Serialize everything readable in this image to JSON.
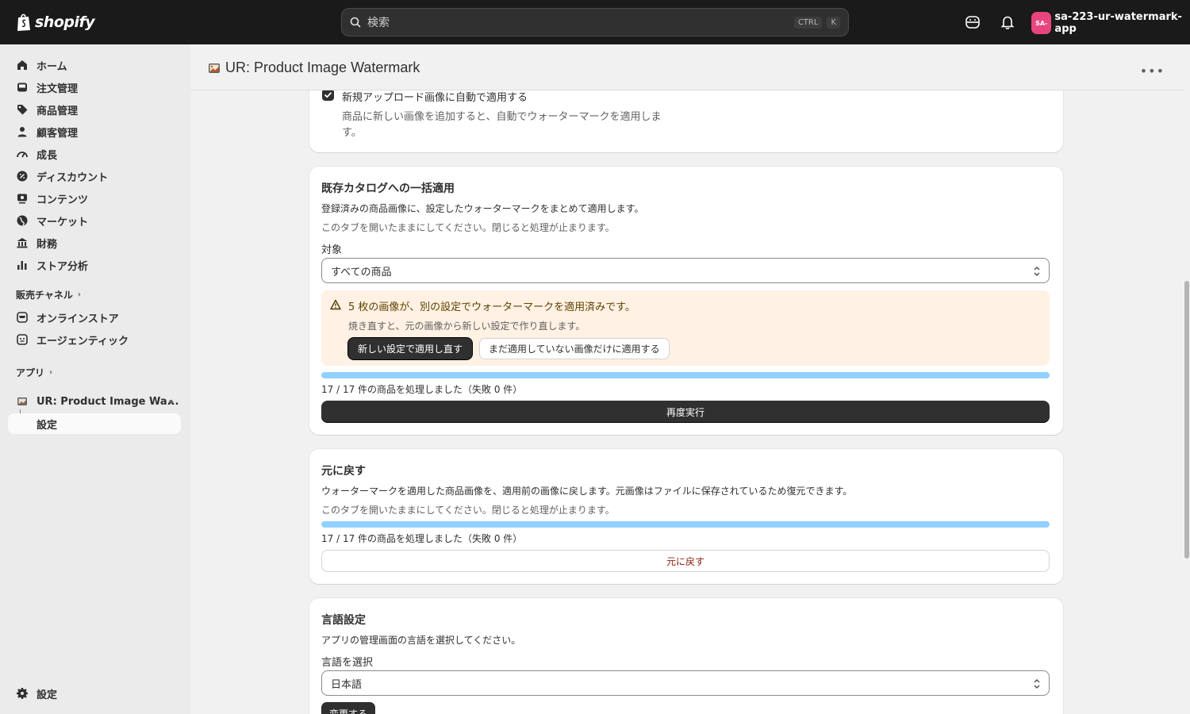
{
  "topbar": {
    "logo_text": "shopify",
    "search_placeholder": "検索",
    "shortcut_ctrl": "CTRL",
    "shortcut_key": "K",
    "avatar_initials": "SA-",
    "store_name": "sa-223-ur-watermark-app"
  },
  "sidebar": {
    "items": [
      {
        "label": "ホーム",
        "icon": "home-icon"
      },
      {
        "label": "注文管理",
        "icon": "inbox-icon"
      },
      {
        "label": "商品管理",
        "icon": "tag-icon"
      },
      {
        "label": "顧客管理",
        "icon": "person-icon"
      },
      {
        "label": "成長",
        "icon": "gauge-icon"
      },
      {
        "label": "ディスカウント",
        "icon": "discount-icon"
      },
      {
        "label": "コンテンツ",
        "icon": "content-icon"
      },
      {
        "label": "マーケット",
        "icon": "globe-icon"
      },
      {
        "label": "財務",
        "icon": "bank-icon"
      },
      {
        "label": "ストア分析",
        "icon": "chart-icon"
      }
    ],
    "sales_channels_label": "販売チャネル",
    "channels": [
      {
        "label": "オンラインストア",
        "icon": "store-icon"
      },
      {
        "label": "エージェンティック",
        "icon": "agent-icon"
      }
    ],
    "apps_label": "アプリ",
    "app_item": "UR: Product Image Wa...",
    "app_sub_item": "設定",
    "settings_label": "設定"
  },
  "header": {
    "title": "UR: Product Image Watermark"
  },
  "auto_apply_card": {
    "checkbox_label": "新規アップロード画像に自動で適用する",
    "help_line1": "商品に新しい画像を追加すると、自動でウォーターマークを適用しま",
    "help_line2": "す。",
    "checked": true
  },
  "bulk_card": {
    "title": "既存カタログへの一括適用",
    "description": "登録済みの商品画像に、設定したウォーターマークをまとめて適用します。",
    "note": "このタブを開いたままにしてください。閉じると処理が止まります。",
    "target_label": "対象",
    "target_value": "すべての商品",
    "banner_title": "5 枚の画像が、別の設定でウォーターマークを適用済みです。",
    "banner_text": "焼き直すと、元の画像から新しい設定で作り直します。",
    "banner_primary": "新しい設定で適用し直す",
    "banner_secondary": "まだ適用していない画像だけに適用する",
    "progress": 1.0,
    "progress_text": "17 / 17 件の商品を処理しました（失敗 0 件）",
    "rerun_label": "再度実行"
  },
  "revert_card": {
    "title": "元に戻す",
    "description": "ウォーターマークを適用した商品画像を、適用前の画像に戻します。元画像はファイルに保存されているため復元できます。",
    "note": "このタブを開いたままにしてください。閉じると処理が止まります。",
    "progress": 1.0,
    "progress_text": "17 / 17 件の商品を処理しました（失敗 0 件）",
    "revert_label": "元に戻す"
  },
  "language_card": {
    "title": "言語設定",
    "description": "アプリの管理画面の言語を選択してください。",
    "select_label": "言語を選択",
    "select_value": "日本語",
    "change_label": "変更する"
  },
  "colors": {
    "topbar": "#1a1a1a",
    "banner_bg": "#fff1e3",
    "progress_fill": "#91d0ff",
    "primary_button": "#303030",
    "critical_text": "#8e1f0b",
    "avatar": "#e8457f"
  }
}
